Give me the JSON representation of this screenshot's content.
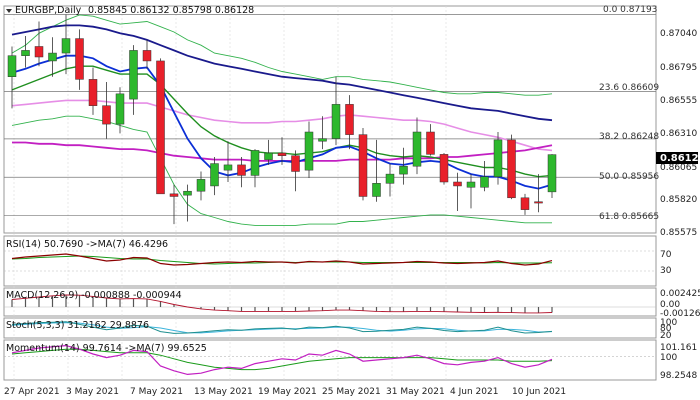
{
  "header": {
    "symbol": "EURGBP,Daily",
    "ohlc": "0.85845 0.86132 0.85798 0.86128"
  },
  "price_axis": {
    "labels": [
      "0.87040",
      "0.86795",
      "0.86555",
      "0.86310",
      "0.86065",
      "0.85820",
      "0.85575"
    ],
    "current_price": "0.86128",
    "current_price_color": "#000000"
  },
  "fib_levels": [
    {
      "label": "0.0 0.87193",
      "value": 0.87193
    },
    {
      "label": "23.6 0.86609",
      "value": 0.86609
    },
    {
      "label": "38.2 0.86248",
      "value": 0.86248
    },
    {
      "label": "50.0 0.85956",
      "value": 0.85956
    },
    {
      "label": "61.8 0.85665",
      "value": 0.85665
    }
  ],
  "date_axis": [
    "27 Apr 2021",
    "3 May 2021",
    "7 May 2021",
    "13 May 2021",
    "19 May 2021",
    "25 May 2021",
    "31 May 2021",
    "4 Jun 2021",
    "10 Jun 2021"
  ],
  "indicators": {
    "rsi": {
      "label": "RSI(14) 50.7690 ->MA(7) 46.4296",
      "levels": [
        "70",
        "30"
      ]
    },
    "macd": {
      "label": "MACD(12,26,9) -0.000888 -0.000944",
      "levels": [
        "0.002425",
        "0.00",
        "-0.00126"
      ]
    },
    "stoch": {
      "label": "Stoch(5,3,3) 31.2162 29.8876",
      "levels": [
        "100",
        "80",
        "20"
      ]
    },
    "momentum": {
      "label": "Momentum(14) 99.7614 ->MA(7) 99.6525",
      "levels": [
        "101.161",
        "100",
        "98.2548"
      ]
    }
  },
  "colors": {
    "bull": "#2db82d",
    "bear": "#e8202a",
    "ma_fast": "#0c2fd6",
    "ma_mid": "#1f8f1f",
    "ma_slow": "#1a1a8c",
    "ma_magenta": "#c21fc2",
    "ma_pink": "#e68ee6",
    "bb": "#33b24d",
    "rsi_line": "#8b0000",
    "rsi_ma": "#1a9b1a",
    "macd_line": "#b2122b",
    "stoch_k": "#1f8f8f",
    "stoch_d": "#3cb4dc",
    "mom_line": "#c21fc2",
    "mom_ma": "#1a9b1a",
    "grid": "#d9d9d9"
  },
  "candles": [
    {
      "o": 0.8672,
      "h": 0.8695,
      "l": 0.8648,
      "c": 0.8688
    },
    {
      "o": 0.8688,
      "h": 0.8703,
      "l": 0.8679,
      "c": 0.8692
    },
    {
      "o": 0.8695,
      "h": 0.8714,
      "l": 0.868,
      "c": 0.8687
    },
    {
      "o": 0.8684,
      "h": 0.8702,
      "l": 0.8672,
      "c": 0.869
    },
    {
      "o": 0.869,
      "h": 0.87193,
      "l": 0.8674,
      "c": 0.8701
    },
    {
      "o": 0.8701,
      "h": 0.8708,
      "l": 0.8662,
      "c": 0.867
    },
    {
      "o": 0.867,
      "h": 0.8679,
      "l": 0.8643,
      "c": 0.865
    },
    {
      "o": 0.865,
      "h": 0.8668,
      "l": 0.8625,
      "c": 0.8636
    },
    {
      "o": 0.8636,
      "h": 0.8664,
      "l": 0.8629,
      "c": 0.8659
    },
    {
      "o": 0.8655,
      "h": 0.8696,
      "l": 0.8643,
      "c": 0.8692
    },
    {
      "o": 0.8692,
      "h": 0.87,
      "l": 0.8678,
      "c": 0.8684
    },
    {
      "o": 0.8684,
      "h": 0.8686,
      "l": 0.861,
      "c": 0.8583
    },
    {
      "o": 0.8583,
      "h": 0.859,
      "l": 0.856,
      "c": 0.8581
    },
    {
      "o": 0.8582,
      "h": 0.859,
      "l": 0.8562,
      "c": 0.8585
    },
    {
      "o": 0.8585,
      "h": 0.86,
      "l": 0.8578,
      "c": 0.8594
    },
    {
      "o": 0.8589,
      "h": 0.8611,
      "l": 0.8582,
      "c": 0.8606
    },
    {
      "o": 0.8601,
      "h": 0.8623,
      "l": 0.8592,
      "c": 0.8605
    },
    {
      "o": 0.8605,
      "h": 0.8611,
      "l": 0.8588,
      "c": 0.8597
    },
    {
      "o": 0.8597,
      "h": 0.8617,
      "l": 0.8588,
      "c": 0.8616
    },
    {
      "o": 0.8609,
      "h": 0.8624,
      "l": 0.8605,
      "c": 0.8614
    },
    {
      "o": 0.8614,
      "h": 0.8626,
      "l": 0.8605,
      "c": 0.8612
    },
    {
      "o": 0.8612,
      "h": 0.8616,
      "l": 0.8585,
      "c": 0.86
    },
    {
      "o": 0.8601,
      "h": 0.8638,
      "l": 0.8595,
      "c": 0.863
    },
    {
      "o": 0.8623,
      "h": 0.8642,
      "l": 0.8617,
      "c": 0.8625
    },
    {
      "o": 0.8625,
      "h": 0.8672,
      "l": 0.862,
      "c": 0.8651
    },
    {
      "o": 0.8651,
      "h": 0.8658,
      "l": 0.8617,
      "c": 0.8628
    },
    {
      "o": 0.8628,
      "h": 0.8633,
      "l": 0.8578,
      "c": 0.8581
    },
    {
      "o": 0.8581,
      "h": 0.8624,
      "l": 0.8577,
      "c": 0.8591
    },
    {
      "o": 0.8591,
      "h": 0.8606,
      "l": 0.8581,
      "c": 0.8598
    },
    {
      "o": 0.8598,
      "h": 0.8618,
      "l": 0.859,
      "c": 0.8604
    },
    {
      "o": 0.8604,
      "h": 0.8641,
      "l": 0.8598,
      "c": 0.863
    },
    {
      "o": 0.863,
      "h": 0.8636,
      "l": 0.8612,
      "c": 0.8613
    },
    {
      "o": 0.8613,
      "h": 0.8614,
      "l": 0.859,
      "c": 0.8592
    },
    {
      "o": 0.8592,
      "h": 0.8599,
      "l": 0.857,
      "c": 0.8589
    },
    {
      "o": 0.8588,
      "h": 0.8598,
      "l": 0.8572,
      "c": 0.8592
    },
    {
      "o": 0.8588,
      "h": 0.8608,
      "l": 0.8585,
      "c": 0.8596
    },
    {
      "o": 0.8596,
      "h": 0.863,
      "l": 0.859,
      "c": 0.8624
    },
    {
      "o": 0.8624,
      "h": 0.8628,
      "l": 0.8579,
      "c": 0.858
    },
    {
      "o": 0.858,
      "h": 0.8583,
      "l": 0.8567,
      "c": 0.8571
    },
    {
      "o": 0.8577,
      "h": 0.8598,
      "l": 0.8569,
      "c": 0.8576
    },
    {
      "o": 0.85845,
      "h": 0.86132,
      "l": 0.85798,
      "c": 0.86128
    }
  ],
  "ma_fast": [
    0.8675,
    0.8678,
    0.8682,
    0.8685,
    0.8688,
    0.8688,
    0.8686,
    0.868,
    0.8676,
    0.8678,
    0.8679,
    0.8665,
    0.8645,
    0.8625,
    0.861,
    0.86,
    0.8597,
    0.8599,
    0.8603,
    0.8606,
    0.8608,
    0.8607,
    0.861,
    0.8613,
    0.8618,
    0.8619,
    0.8615,
    0.861,
    0.8606,
    0.8605,
    0.8607,
    0.8608,
    0.8607,
    0.8602,
    0.8598,
    0.8596,
    0.8596,
    0.8593,
    0.8589,
    0.8587,
    0.859
  ],
  "ma_mid": [
    0.8662,
    0.8666,
    0.867,
    0.8674,
    0.8678,
    0.868,
    0.868,
    0.8677,
    0.8674,
    0.8674,
    0.8674,
    0.8666,
    0.8655,
    0.8644,
    0.8634,
    0.8627,
    0.8622,
    0.8618,
    0.8615,
    0.8614,
    0.8614,
    0.8613,
    0.8614,
    0.8615,
    0.8618,
    0.862,
    0.8618,
    0.8614,
    0.8612,
    0.8611,
    0.8612,
    0.8611,
    0.8609,
    0.8607,
    0.8605,
    0.8603,
    0.8603,
    0.8601,
    0.8598,
    0.8596,
    0.8597
  ],
  "ma_slow": [
    0.8704,
    0.8706,
    0.8708,
    0.871,
    0.8711,
    0.8711,
    0.871,
    0.8708,
    0.8705,
    0.8703,
    0.87,
    0.8696,
    0.8692,
    0.8688,
    0.8685,
    0.8682,
    0.868,
    0.8678,
    0.8676,
    0.8674,
    0.8672,
    0.8671,
    0.867,
    0.8669,
    0.8667,
    0.8666,
    0.8664,
    0.8662,
    0.866,
    0.8658,
    0.8656,
    0.8654,
    0.8652,
    0.865,
    0.8648,
    0.8647,
    0.8646,
    0.8644,
    0.8642,
    0.864,
    0.8639
  ],
  "ma_magenta": [
    0.8622,
    0.8622,
    0.8621,
    0.8621,
    0.862,
    0.862,
    0.8619,
    0.8618,
    0.8617,
    0.8617,
    0.8616,
    0.8614,
    0.8612,
    0.8611,
    0.861,
    0.8609,
    0.8609,
    0.8609,
    0.8608,
    0.8608,
    0.8608,
    0.8608,
    0.8608,
    0.8608,
    0.8608,
    0.8609,
    0.8609,
    0.8609,
    0.8609,
    0.861,
    0.861,
    0.861,
    0.8611,
    0.8611,
    0.8612,
    0.8613,
    0.8614,
    0.8615,
    0.8616,
    0.8618,
    0.862
  ],
  "ma_pink": [
    0.865,
    0.8651,
    0.8652,
    0.8653,
    0.8654,
    0.8654,
    0.8654,
    0.8653,
    0.8652,
    0.8652,
    0.8652,
    0.8649,
    0.8646,
    0.8643,
    0.8641,
    0.8639,
    0.8638,
    0.8637,
    0.8637,
    0.8637,
    0.8638,
    0.8638,
    0.8639,
    0.864,
    0.8642,
    0.8643,
    0.8642,
    0.8641,
    0.864,
    0.8639,
    0.8639,
    0.8638,
    0.8636,
    0.8633,
    0.863,
    0.8628,
    0.8626,
    0.8623,
    0.862,
    0.8617,
    0.8616
  ],
  "bb_upper": [
    0.869,
    0.8696,
    0.8705,
    0.871,
    0.8715,
    0.8719,
    0.8718,
    0.8715,
    0.8712,
    0.8713,
    0.8714,
    0.871,
    0.8706,
    0.87,
    0.8696,
    0.869,
    0.8688,
    0.8686,
    0.8683,
    0.8679,
    0.8676,
    0.8674,
    0.8672,
    0.867,
    0.8672,
    0.8672,
    0.867,
    0.8669,
    0.8668,
    0.8666,
    0.8664,
    0.8662,
    0.866,
    0.8659,
    0.8659,
    0.866,
    0.866,
    0.8659,
    0.8658,
    0.8658,
    0.8659
  ],
  "bb_lower": [
    0.8635,
    0.8637,
    0.8639,
    0.864,
    0.8642,
    0.8642,
    0.864,
    0.8638,
    0.8635,
    0.8632,
    0.863,
    0.861,
    0.859,
    0.8575,
    0.8568,
    0.8565,
    0.8562,
    0.856,
    0.8559,
    0.8559,
    0.8559,
    0.8559,
    0.856,
    0.856,
    0.856,
    0.8562,
    0.8562,
    0.8563,
    0.8564,
    0.8565,
    0.8566,
    0.8567,
    0.8567,
    0.8566,
    0.8565,
    0.8564,
    0.8563,
    0.8562,
    0.8561,
    0.8561,
    0.8561
  ],
  "rsi": [
    55,
    58,
    60,
    62,
    64,
    60,
    55,
    50,
    52,
    57,
    56,
    45,
    42,
    43,
    45,
    47,
    48,
    47,
    49,
    48,
    48,
    46,
    49,
    48,
    50,
    48,
    44,
    45,
    46,
    47,
    49,
    48,
    46,
    45,
    46,
    47,
    50,
    45,
    42,
    44,
    50.769
  ],
  "rsi_ma": [
    54,
    55,
    57,
    58,
    59,
    60,
    59,
    57,
    55,
    54,
    54,
    51,
    49,
    47,
    45,
    44,
    45,
    46,
    46,
    47,
    48,
    47,
    48,
    48,
    48,
    48,
    47,
    47,
    47,
    47,
    47,
    47,
    47,
    47,
    47,
    46,
    47,
    46,
    46,
    46,
    46.43
  ],
  "macd": [
    0.0012,
    0.0014,
    0.0016,
    0.0018,
    0.00195,
    0.0019,
    0.0017,
    0.00145,
    0.0013,
    0.00135,
    0.0013,
    0.0009,
    0.0004,
    0.0,
    -0.0003,
    -0.0005,
    -0.0006,
    -0.0007,
    -0.0007,
    -0.0007,
    -0.0007,
    -0.0007,
    -0.00065,
    -0.0006,
    -0.0005,
    -0.0005,
    -0.0006,
    -0.0007,
    -0.00075,
    -0.00075,
    -0.0007,
    -0.0007,
    -0.00075,
    -0.0008,
    -0.00085,
    -0.00088,
    -0.00085,
    -0.0009,
    -0.00095,
    -0.00095,
    -0.00089
  ],
  "stoch_k": [
    70,
    75,
    80,
    82,
    85,
    70,
    55,
    40,
    50,
    65,
    60,
    30,
    20,
    22,
    28,
    35,
    40,
    38,
    45,
    48,
    50,
    42,
    55,
    52,
    60,
    50,
    30,
    32,
    38,
    42,
    55,
    48,
    36,
    30,
    34,
    38,
    55,
    35,
    22,
    25,
    31.2
  ],
  "stoch_d": [
    65,
    70,
    75,
    78,
    80,
    77,
    68,
    55,
    48,
    52,
    58,
    50,
    36,
    24,
    23,
    28,
    34,
    38,
    40,
    44,
    47,
    46,
    48,
    50,
    55,
    54,
    47,
    37,
    33,
    37,
    45,
    48,
    46,
    38,
    33,
    34,
    42,
    42,
    37,
    28,
    29.9
  ],
  "momentum": [
    100.3,
    100.5,
    100.7,
    100.8,
    100.9,
    100.6,
    100.2,
    99.9,
    100.1,
    100.5,
    100.4,
    99.2,
    98.8,
    98.5,
    98.6,
    98.9,
    99.1,
    99.0,
    99.4,
    99.6,
    99.8,
    99.7,
    100.2,
    100.1,
    100.5,
    100.2,
    99.6,
    99.7,
    99.8,
    99.9,
    100.1,
    99.8,
    99.4,
    99.3,
    99.5,
    99.6,
    99.9,
    99.4,
    99.1,
    99.3,
    99.76
  ],
  "mom_ma": [
    100.2,
    100.3,
    100.4,
    100.5,
    100.6,
    100.6,
    100.5,
    100.4,
    100.3,
    100.3,
    100.3,
    100.1,
    99.8,
    99.5,
    99.3,
    99.1,
    99.0,
    98.9,
    98.9,
    99.0,
    99.2,
    99.4,
    99.6,
    99.7,
    99.8,
    99.9,
    99.9,
    99.9,
    99.9,
    99.9,
    99.9,
    99.9,
    99.8,
    99.7,
    99.7,
    99.7,
    99.7,
    99.6,
    99.6,
    99.6,
    99.65
  ]
}
